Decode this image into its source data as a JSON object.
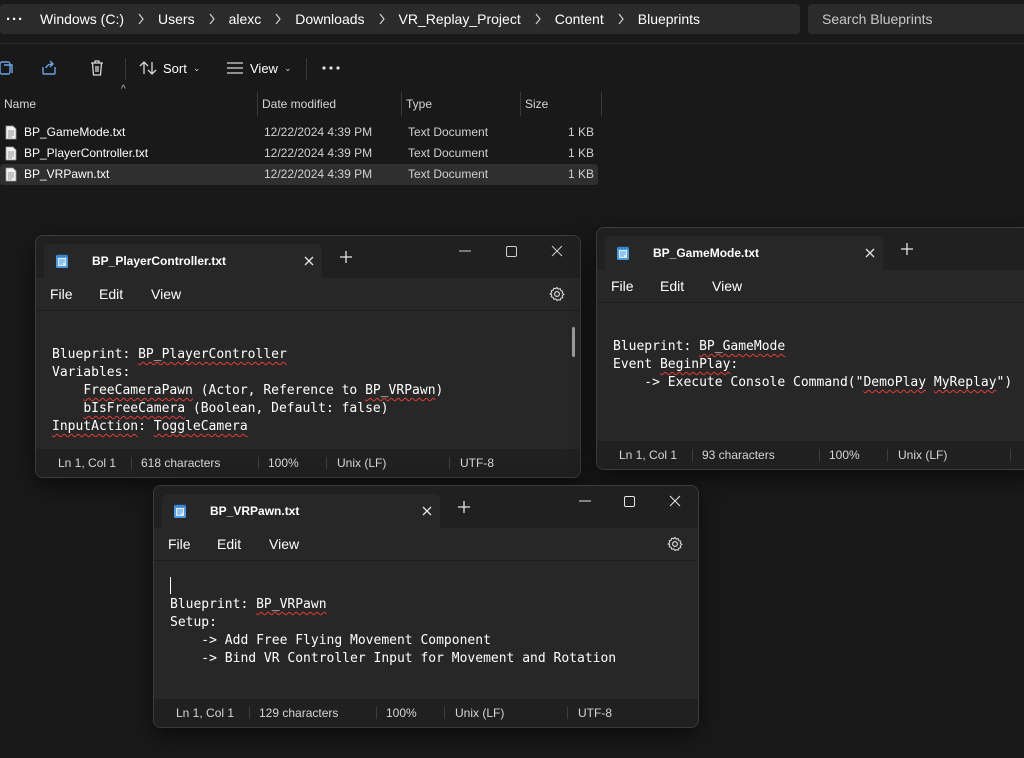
{
  "explorer": {
    "breadcrumb": [
      "Windows (C:)",
      "Users",
      "alexc",
      "Downloads",
      "VR_Replay_Project",
      "Content",
      "Blueprints"
    ],
    "search_placeholder": "Search Blueprints",
    "toolbar": {
      "sort_label": "Sort",
      "view_label": "View"
    },
    "columns": {
      "name": "Name",
      "date": "Date modified",
      "type": "Type",
      "size": "Size"
    },
    "files": [
      {
        "name": "BP_GameMode.txt",
        "date": "12/22/2024 4:39 PM",
        "type": "Text Document",
        "size": "1 KB"
      },
      {
        "name": "BP_PlayerController.txt",
        "date": "12/22/2024 4:39 PM",
        "type": "Text Document",
        "size": "1 KB"
      },
      {
        "name": "BP_VRPawn.txt",
        "date": "12/22/2024 4:39 PM",
        "type": "Text Document",
        "size": "1 KB"
      }
    ]
  },
  "notepad_player_controller": {
    "tab_title": "BP_PlayerController.txt",
    "menu": {
      "file": "File",
      "edit": "Edit",
      "view": "View"
    },
    "lines": [
      "Blueprint: BP_PlayerController",
      "Variables:",
      "    FreeCameraPawn (Actor, Reference to BP_VRPawn)",
      "    bIsFreeCamera (Boolean, Default: false)",
      "",
      "InputAction: ToggleCamera"
    ],
    "status": {
      "position": "Ln 1, Col 1",
      "characters": "618 characters",
      "zoom": "100%",
      "line_ending": "Unix (LF)",
      "encoding": "UTF-8"
    }
  },
  "notepad_gamemode": {
    "tab_title": "BP_GameMode.txt",
    "menu": {
      "file": "File",
      "edit": "Edit",
      "view": "View"
    },
    "lines": [
      "Blueprint: BP_GameMode",
      "Event BeginPlay:",
      "    -> Execute Console Command(\"DemoPlay MyReplay\")"
    ],
    "status": {
      "position": "Ln 1, Col 1",
      "characters": "93 characters",
      "zoom": "100%",
      "line_ending": "Unix (LF)"
    }
  },
  "notepad_vrpawn": {
    "tab_title": "BP_VRPawn.txt",
    "menu": {
      "file": "File",
      "edit": "Edit",
      "view": "View"
    },
    "lines": [
      "Blueprint: BP_VRPawn",
      "Setup:",
      "    -> Add Free Flying Movement Component",
      "    -> Bind VR Controller Input for Movement and Rotation"
    ],
    "status": {
      "position": "Ln 1, Col 1",
      "characters": "129 characters",
      "zoom": "100%",
      "line_ending": "Unix (LF)",
      "encoding": "UTF-8"
    }
  },
  "icons": {
    "breadcrumb_separator": "chevron-right-icon",
    "notepad_icon": "notepad-icon",
    "text_file_icon": "text-file-icon"
  }
}
